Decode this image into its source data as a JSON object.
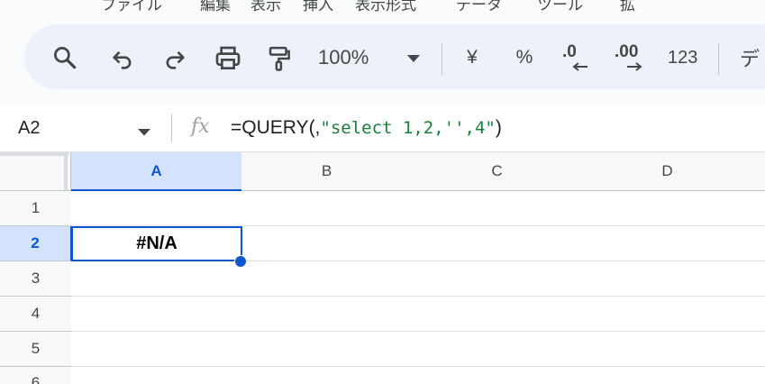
{
  "menu_partial": [
    "ファイル",
    "編集",
    "表示",
    "挿入",
    "表示形式",
    "データ",
    "ツール",
    "拡"
  ],
  "toolbar": {
    "zoom": "100%",
    "currency": "¥",
    "percent": "%",
    "decrease_decimal": ".0",
    "increase_decimal": ".00",
    "number_format": "123",
    "font_partial": "デ"
  },
  "formula_bar": {
    "name_box": "A2",
    "fx": "fx",
    "formula_prefix": "=QUERY(,",
    "formula_string": "\"select 1,2,'',4\"",
    "formula_suffix": ")"
  },
  "columns": [
    "A",
    "B",
    "C",
    "D"
  ],
  "rows": [
    "1",
    "2",
    "3",
    "4",
    "5",
    "6"
  ],
  "cells": {
    "A2": "#N/A"
  },
  "colors": {
    "accent": "#0b57d0",
    "selected_header": "#d3e3fd",
    "string_literal": "#188038",
    "toolbar_bg": "#edf2fa"
  }
}
